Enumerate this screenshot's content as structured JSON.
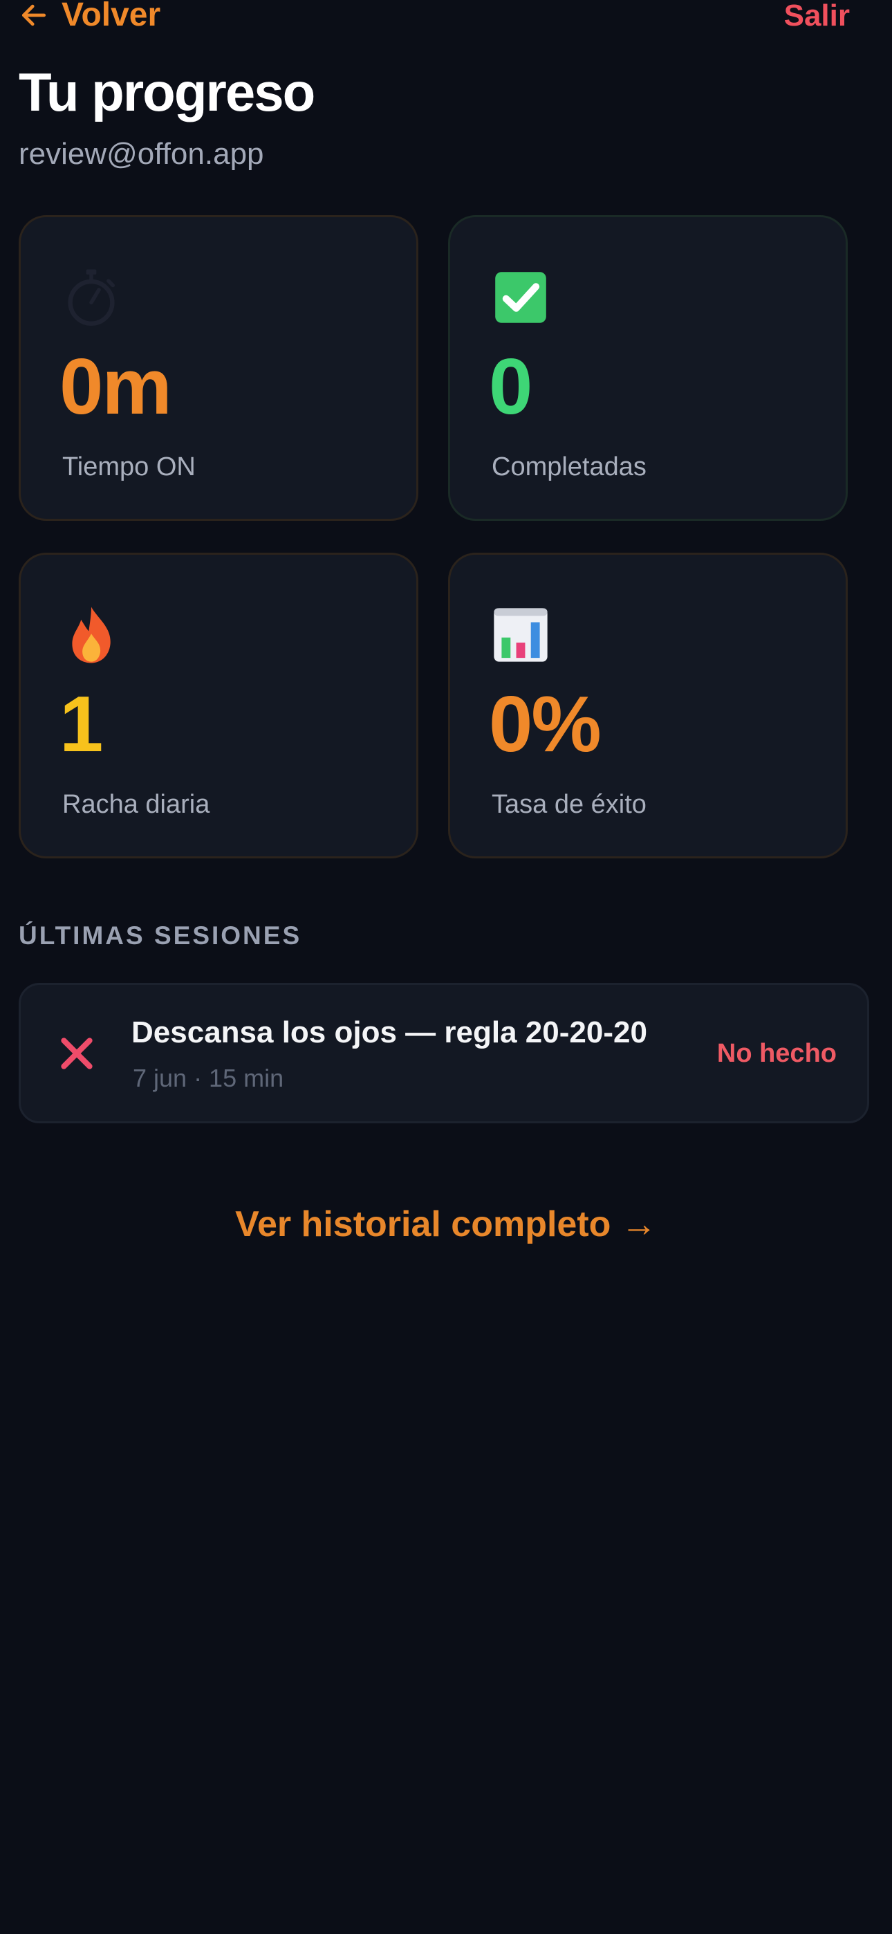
{
  "header": {
    "back_label": "Volver",
    "logout_label": "Salir",
    "title": "Tu progreso",
    "email": "review@offon.app"
  },
  "stats": [
    {
      "icon": "stopwatch-icon",
      "value": "0m",
      "label": "Tiempo ON",
      "color": "#f0892a"
    },
    {
      "icon": "check-box-icon",
      "value": "0",
      "label": "Completadas",
      "color": "#3ed676"
    },
    {
      "icon": "fire-icon",
      "value": "1",
      "label": "Racha diaria",
      "color": "#f7c21c"
    },
    {
      "icon": "bar-chart-icon",
      "value": "0%",
      "label": "Tasa de éxito",
      "color": "#f0892a"
    }
  ],
  "sessions": {
    "heading": "ÚLTIMAS SESIONES",
    "items": [
      {
        "icon": "cross-icon",
        "title": "Descansa los ojos — regla 20-20-20",
        "meta": "7 jun · 15 min",
        "status": "No hecho"
      }
    ]
  },
  "history_link": "Ver historial completo →",
  "colors": {
    "background": "#0b0e17",
    "card": "#131823",
    "accent": "#f0892a",
    "danger": "#f0505d",
    "success": "#3ed676",
    "streak": "#f7c21c"
  }
}
